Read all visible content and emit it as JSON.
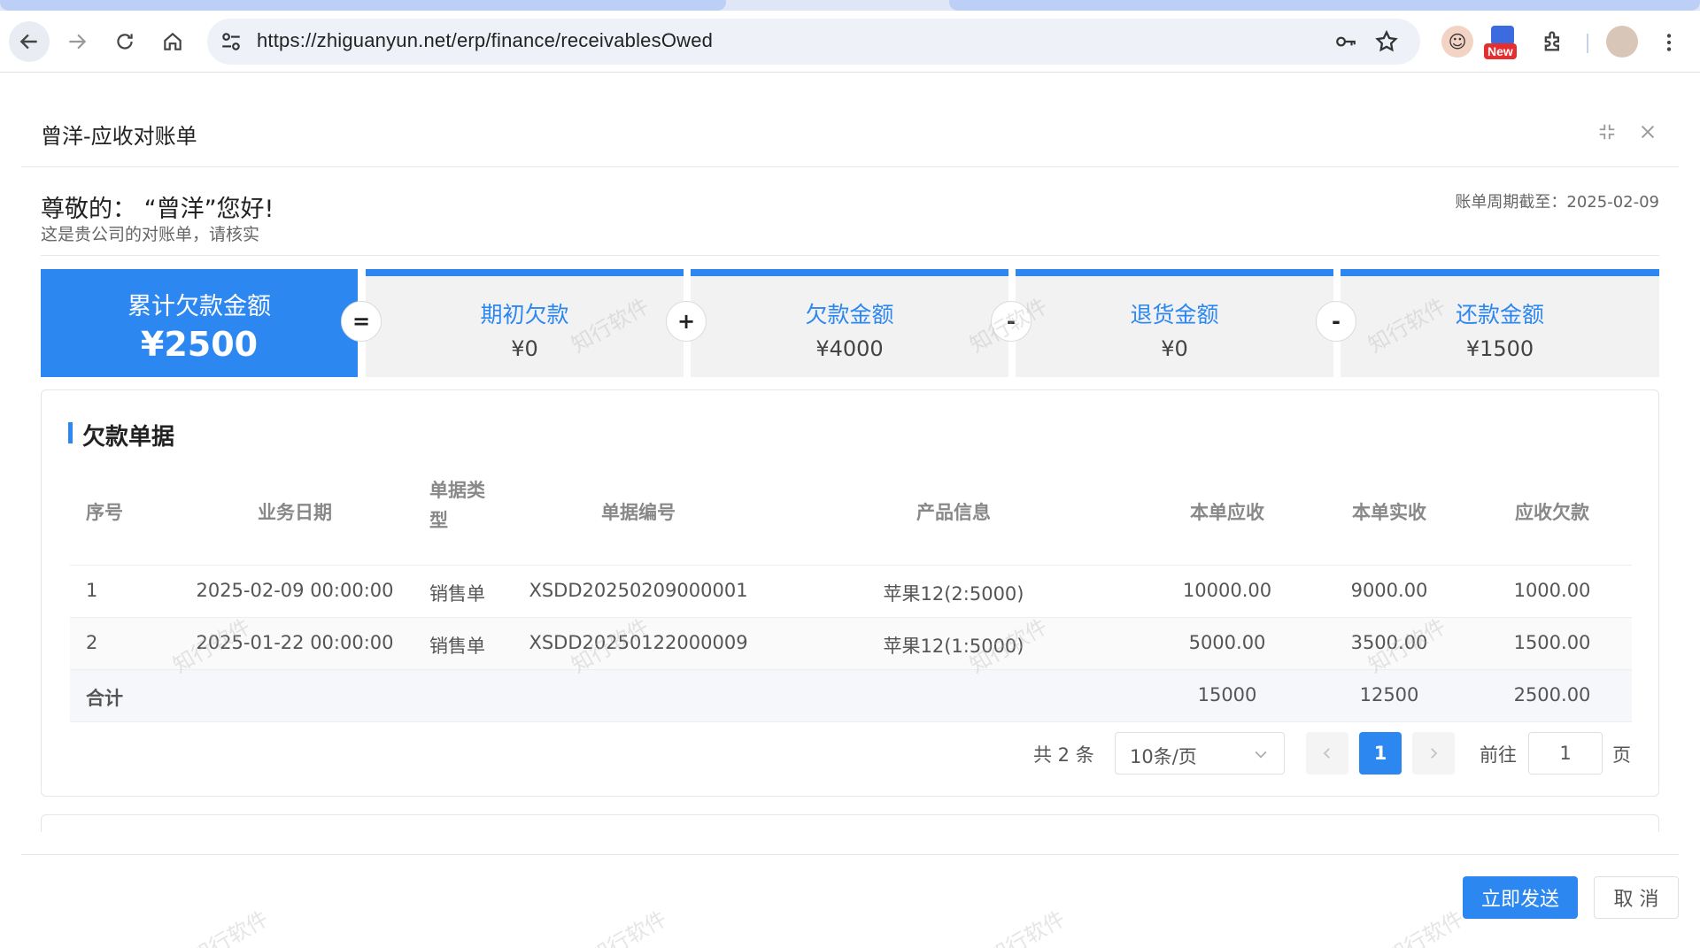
{
  "browser": {
    "url": "https://zhiguanyun.net/erp/finance/receivablesOwed",
    "ext_badge": "New"
  },
  "dialog": {
    "title": "曾洋-应收对账单",
    "greeting": "尊敬的： “曾洋”您好!",
    "sub": "这是贵公司的对账单，请核实",
    "period": "账单周期截至：2025-02-09"
  },
  "summary": {
    "main": {
      "label": "累计欠款金额",
      "value": "¥2500"
    },
    "cards": [
      {
        "label": "期初欠款",
        "value": "¥0"
      },
      {
        "label": "欠款金额",
        "value": "¥4000"
      },
      {
        "label": "退货金额",
        "value": "¥0"
      },
      {
        "label": "还款金额",
        "value": "¥1500"
      }
    ],
    "ops": [
      "=",
      "+",
      "-",
      "-"
    ]
  },
  "table": {
    "title": "欠款单据",
    "headers": [
      "序号",
      "业务日期",
      "单据类型",
      "单据编号",
      "产品信息",
      "本单应收",
      "本单实收",
      "应收欠款"
    ],
    "rows": [
      [
        "1",
        "2025-02-09 00:00:00",
        "销售单",
        "XSDD20250209000001",
        "苹果12(2:5000)",
        "10000.00",
        "9000.00",
        "1000.00"
      ],
      [
        "2",
        "2025-01-22 00:00:00",
        "销售单",
        "XSDD20250122000009",
        "苹果12(1:5000)",
        "5000.00",
        "3500.00",
        "1500.00"
      ]
    ],
    "summary": {
      "label": "合计",
      "receivable": "15000",
      "received": "12500",
      "owed": "2500.00"
    }
  },
  "pager": {
    "total": "共 2 条",
    "page_size": "10条/页",
    "current": "1",
    "goto_prefix": "前往",
    "goto_value": "1",
    "goto_suffix": "页"
  },
  "footer": {
    "send": "立即发送",
    "cancel": "取 消"
  },
  "watermark": "知行软件",
  "colors": {
    "accent": "#2d87f0"
  }
}
